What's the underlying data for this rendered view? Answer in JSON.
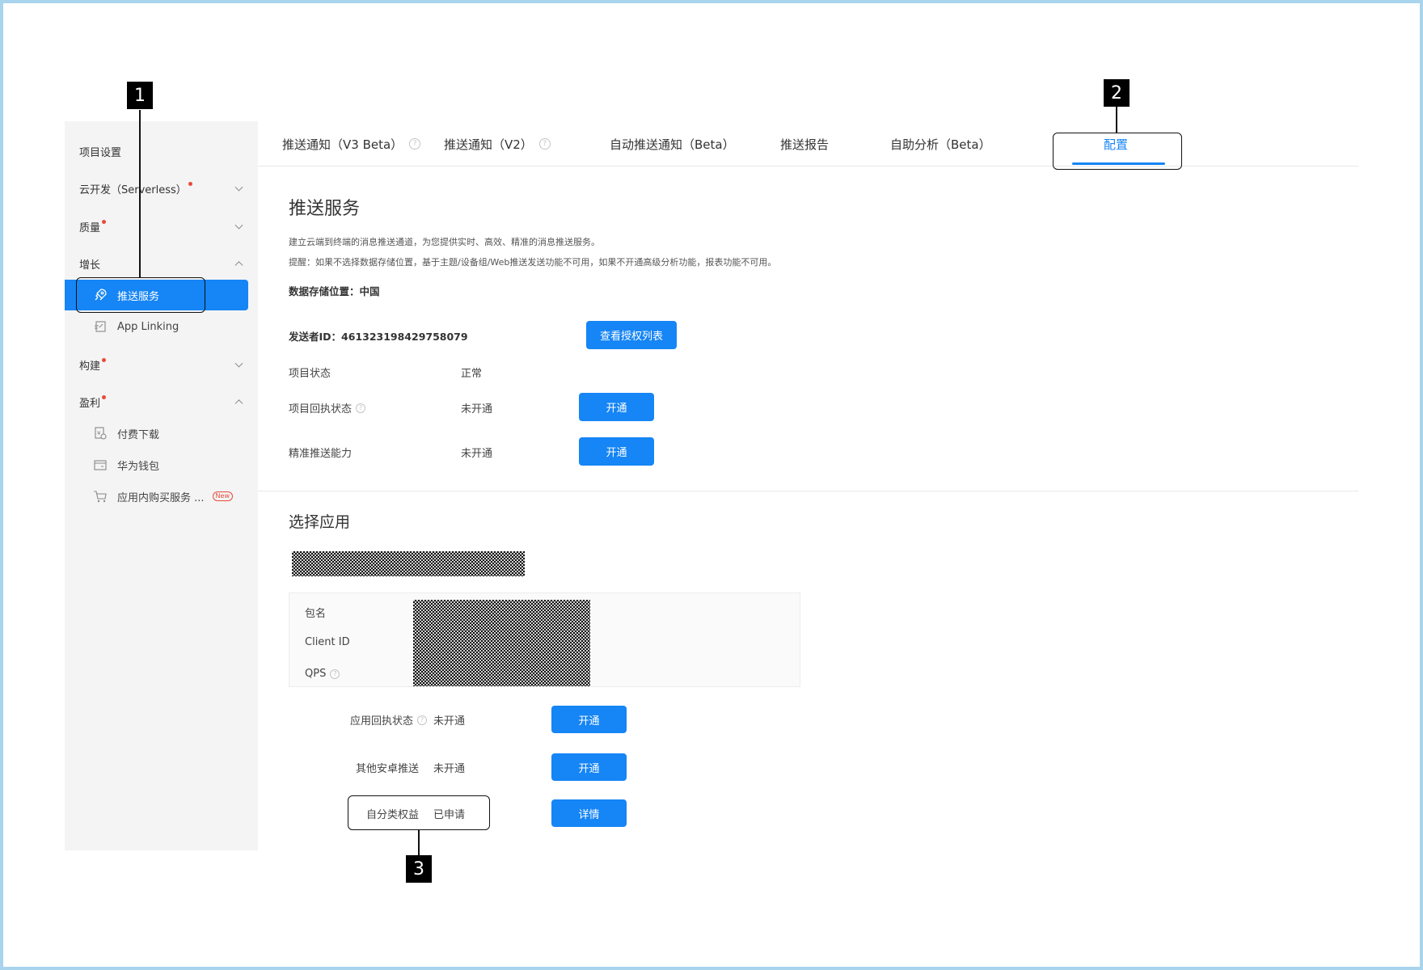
{
  "sidebar": {
    "items": [
      {
        "label": "项目设置"
      },
      {
        "label": "云开发（Serverless）"
      },
      {
        "label": "质量"
      },
      {
        "label": "增长"
      },
      {
        "label": "推送服务"
      },
      {
        "label": "App Linking"
      },
      {
        "label": "构建"
      },
      {
        "label": "盈利"
      },
      {
        "label": "付费下载"
      },
      {
        "label": "华为钱包"
      },
      {
        "label": "应用内购买服务 ..."
      }
    ],
    "new_badge": "New"
  },
  "tabs": [
    {
      "label": "推送通知（V3 Beta）"
    },
    {
      "label": "推送通知（V2）"
    },
    {
      "label": "自动推送通知（Beta）"
    },
    {
      "label": "推送报告"
    },
    {
      "label": "自助分析（Beta）"
    },
    {
      "label": "配置"
    }
  ],
  "service": {
    "title": "推送服务",
    "desc1": "建立云端到终端的消息推送通道，为您提供实时、高效、精准的消息推送服务。",
    "desc2": "提醒：如果不选择数据存储位置，基于主题/设备组/Web推送发送功能不可用，如果不开通高级分析功能，报表功能不可用。",
    "storage": "数据存储位置：中国",
    "sender_id": "发送者ID：461323198429758079",
    "view_auth_button": "查看授权列表",
    "rows": [
      {
        "label": "项目状态",
        "value": "正常"
      },
      {
        "label": "项目回执状态",
        "value": "未开通",
        "button": "开通"
      },
      {
        "label": "精准推送能力",
        "value": "未开通",
        "button": "开通"
      }
    ]
  },
  "app": {
    "title": "选择应用",
    "info_labels": [
      "包名",
      "Client ID",
      "QPS"
    ],
    "rows": [
      {
        "label": "应用回执状态",
        "value": "未开通",
        "button": "开通"
      },
      {
        "label": "其他安卓推送",
        "value": "未开通",
        "button": "开通"
      },
      {
        "label": "自分类权益",
        "value": "已申请",
        "button": "详情"
      }
    ]
  },
  "callouts": [
    "1",
    "2",
    "3"
  ],
  "colors": {
    "accent": "#1685f5",
    "sidebar_bg": "#f4f4f4",
    "frame": "#a8d4ee",
    "reddot": "#e84a3b"
  }
}
